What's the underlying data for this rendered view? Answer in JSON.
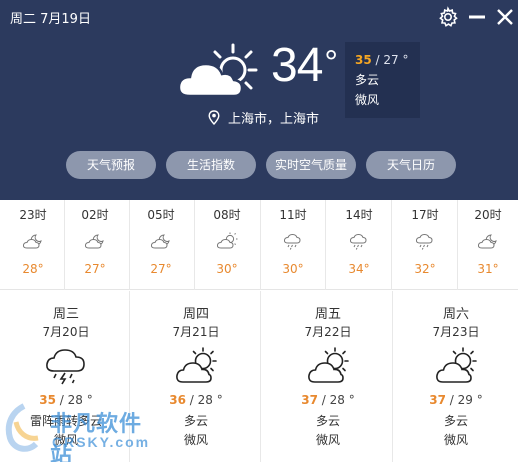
{
  "header": {
    "date": "周二 7月19日",
    "current_temp": "34",
    "degree_symbol": "°",
    "location": "上海市，上海市",
    "high": "35",
    "low": "/ 27 °",
    "condition": "多云",
    "wind": "微风",
    "icons": {
      "settings": "gear-icon",
      "minimize": "minimize-icon",
      "close": "close-icon",
      "location": "location-pin-icon",
      "weather": "partly-cloudy-day-icon"
    }
  },
  "tabs": [
    {
      "label": "天气预报"
    },
    {
      "label": "生活指数"
    },
    {
      "label": "实时空气质量"
    },
    {
      "label": "天气日历"
    }
  ],
  "hourly": [
    {
      "time": "23时",
      "temp": "28°",
      "icon": "partly-cloudy-night-icon"
    },
    {
      "time": "02时",
      "temp": "27°",
      "icon": "partly-cloudy-night-icon"
    },
    {
      "time": "05时",
      "temp": "27°",
      "icon": "partly-cloudy-night-icon"
    },
    {
      "time": "08时",
      "temp": "30°",
      "icon": "partly-cloudy-day-icon"
    },
    {
      "time": "11时",
      "temp": "30°",
      "icon": "rain-cloud-icon"
    },
    {
      "time": "14时",
      "temp": "34°",
      "icon": "rain-cloud-icon"
    },
    {
      "time": "17时",
      "temp": "32°",
      "icon": "rain-cloud-icon"
    },
    {
      "time": "20时",
      "temp": "31°",
      "icon": "cloud-icon"
    }
  ],
  "daily": [
    {
      "weekday": "周三",
      "date": "7月20日",
      "high": "35",
      "low": " / 28 °",
      "condition": "雷阵雨转多云",
      "wind": "微风",
      "icon": "thunderstorm-icon"
    },
    {
      "weekday": "周四",
      "date": "7月21日",
      "high": "36",
      "low": " / 28 °",
      "condition": "多云",
      "wind": "微风",
      "icon": "partly-cloudy-day-icon"
    },
    {
      "weekday": "周五",
      "date": "7月22日",
      "high": "37",
      "low": " / 28 °",
      "condition": "多云",
      "wind": "微风",
      "icon": "partly-cloudy-day-icon"
    },
    {
      "weekday": "周六",
      "date": "7月23日",
      "high": "37",
      "low": " / 29 °",
      "condition": "多云",
      "wind": "微风",
      "icon": "partly-cloudy-day-icon"
    }
  ],
  "watermark": {
    "name": "非凡软件站",
    "url": "CRSKY.com"
  },
  "colors": {
    "header_bg": "#2c3a5e",
    "detail_bg": "#233051",
    "tab_bg": "#8d97ad",
    "temp_accent": "#e8892f",
    "high_accent": "#f5a623"
  }
}
